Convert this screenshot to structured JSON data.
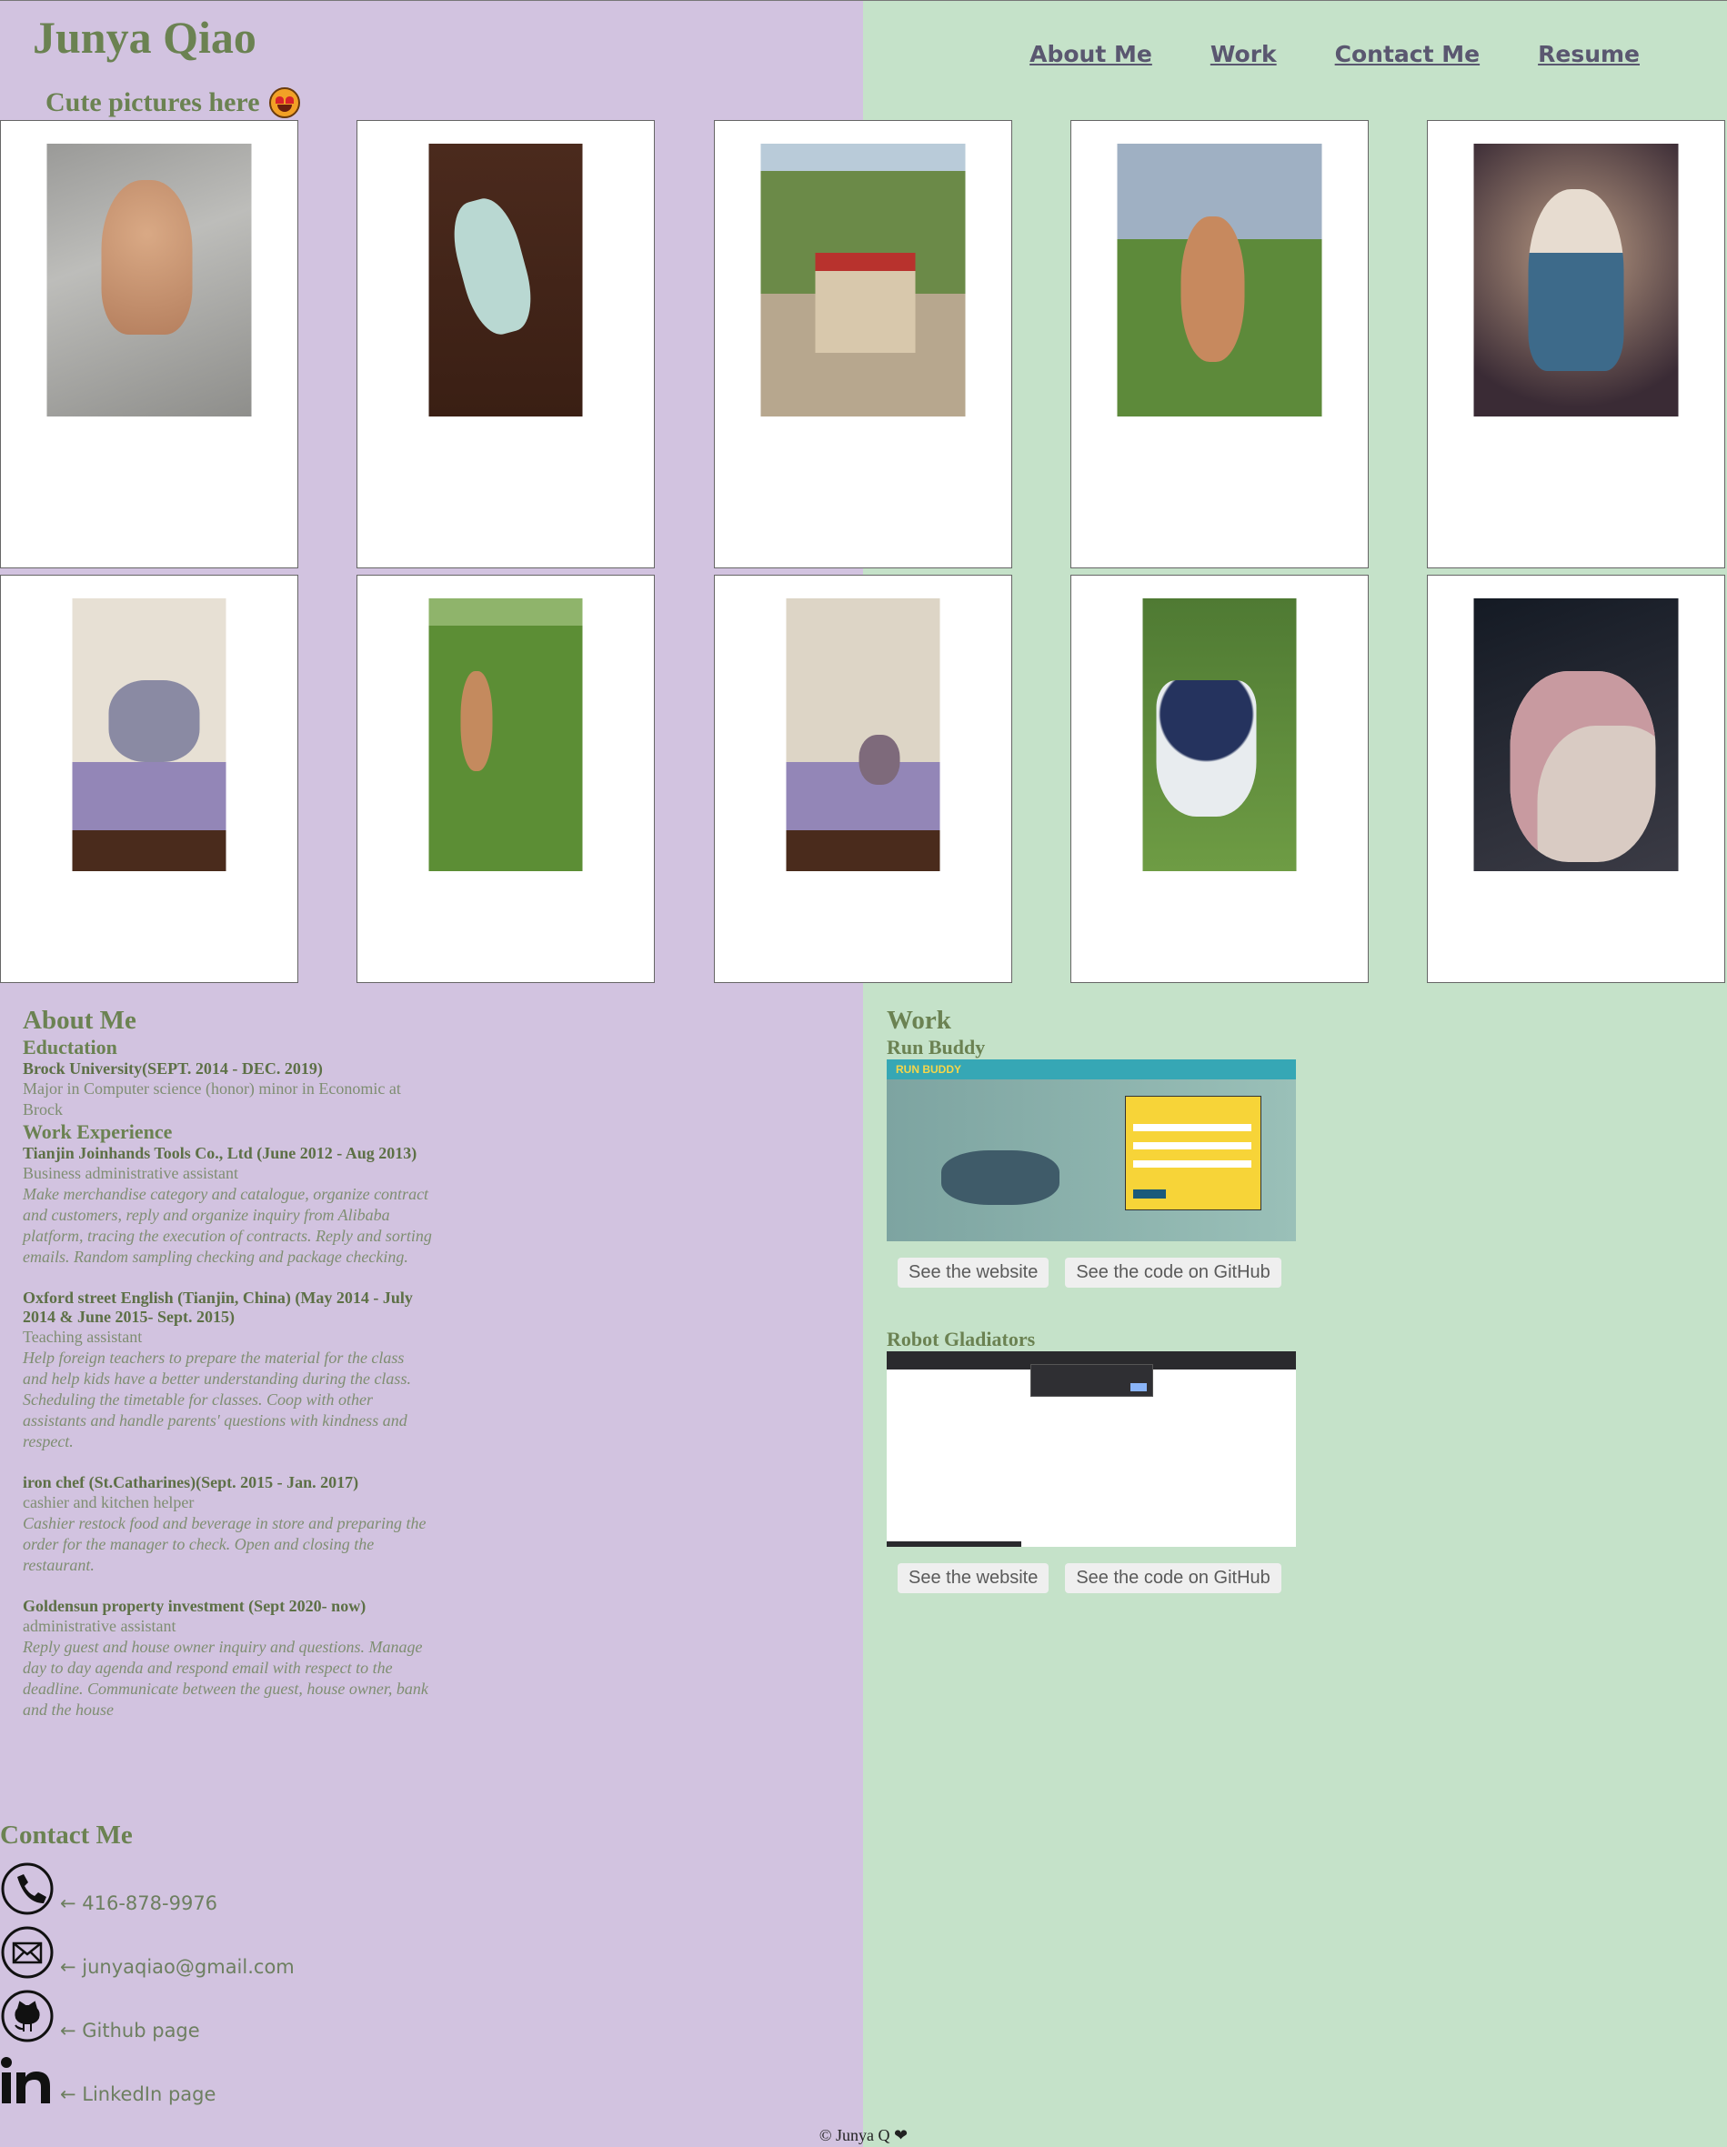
{
  "header": {
    "name": "Junya Qiao",
    "nav": [
      "About Me",
      "Work",
      "Contact Me",
      "Resume"
    ],
    "subtitle": "Cute pictures here"
  },
  "gallery": {
    "photo_icons": [
      "poodle-photo-icon",
      "cat-sweater-photo-icon",
      "strawberry-box-photo-icon",
      "poodle-sidewalk-photo-icon",
      "cat-armor-art-icon",
      "hairless-cat-photo-icon",
      "dog-park-photo-icon",
      "cat-corner-photo-icon",
      "blueberry-bucket-photo-icon",
      "cat-in-arms-photo-icon"
    ]
  },
  "about": {
    "heading": "About Me",
    "education_heading": "Eductation",
    "school": "Brock University(SEPT. 2014 - DEC. 2019)",
    "major": "Major in Computer science (honor) minor in Economic at Brock",
    "work_heading": "Work Experience",
    "jobs": [
      {
        "title": "Tianjin Joinhands Tools Co., Ltd (June 2012 - Aug 2013)",
        "role": "Business administrative assistant",
        "desc": "Make merchandise category and catalogue, organize contract and customers, reply and organize inquiry from Alibaba platform, tracing the execution of contracts. Reply and sorting emails. Random sampling checking and package checking."
      },
      {
        "title": "Oxford street English (Tianjin, China) (May 2014 - July 2014 & June 2015- Sept. 2015)",
        "role": "Teaching assistant",
        "desc": "Help foreign teachers to prepare the material for the class and help kids have a better understanding during the class. Scheduling the timetable for classes. Coop with other assistants and handle parents' questions with kindness and respect."
      },
      {
        "title": "iron chef (St.Catharines)(Sept. 2015 - Jan. 2017)",
        "role": "cashier and kitchen helper",
        "desc": "Cashier restock food and beverage in store and preparing the order for the manager to check. Open and closing the restaurant."
      },
      {
        "title": "Goldensun property investment (Sept 2020- now)",
        "role": "administrative assistant",
        "desc": "Reply guest and house owner inquiry and questions. Manage day to day agenda and respond email with respect to the deadline. Communicate between the guest, house owner, bank and the house"
      }
    ]
  },
  "work": {
    "heading": "Work",
    "projects": [
      {
        "name": "Run Buddy",
        "shot_brand": "RUN BUDDY",
        "website_label": "See the website",
        "github_label": "See the code on GitHub"
      },
      {
        "name": "Robot Gladiators",
        "website_label": "See the website",
        "github_label": "See the code on GitHub"
      }
    ]
  },
  "contact": {
    "heading": "Contact Me",
    "items": [
      {
        "icon": "phone-icon",
        "text": "← 416-878-9976"
      },
      {
        "icon": "envelope-icon",
        "text": "← junyaqiao@gmail.com"
      },
      {
        "icon": "github-icon",
        "text": "← Github page"
      },
      {
        "icon": "linkedin-icon",
        "text": "← LinkedIn page"
      }
    ]
  },
  "footer": {
    "text": "© Junya Q ❤"
  },
  "colors": {
    "left_bg": "#d2c3e0",
    "right_bg": "#c5e2c9",
    "heading": "#6b8252",
    "nav": "#5a5770"
  }
}
